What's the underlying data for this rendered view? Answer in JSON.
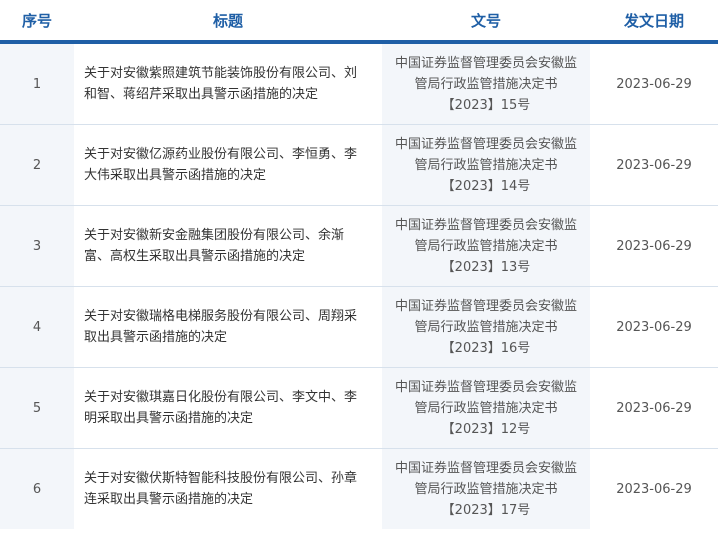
{
  "header": {
    "col_index": "序号",
    "col_title": "标题",
    "col_doc": "文号",
    "col_date": "发文日期"
  },
  "rows": [
    {
      "index": "1",
      "title": "关于对安徽紫照建筑节能装饰股份有限公司、刘和智、蒋绍芹采取出具警示函措施的决定",
      "doc_line1": "中国证券监督管理委员会安徽监",
      "doc_line2": "管局行政监管措施决定书",
      "doc_line3": "【2023】15号",
      "date": "2023-06-29"
    },
    {
      "index": "2",
      "title": "关于对安徽亿源药业股份有限公司、李恒勇、李大伟采取出具警示函措施的决定",
      "doc_line1": "中国证券监督管理委员会安徽监",
      "doc_line2": "管局行政监管措施决定书",
      "doc_line3": "【2023】14号",
      "date": "2023-06-29"
    },
    {
      "index": "3",
      "title": "关于对安徽新安金融集团股份有限公司、余渐富、高权生采取出具警示函措施的决定",
      "doc_line1": "中国证券监督管理委员会安徽监",
      "doc_line2": "管局行政监管措施决定书",
      "doc_line3": "【2023】13号",
      "date": "2023-06-29"
    },
    {
      "index": "4",
      "title": "关于对安徽瑞格电梯服务股份有限公司、周翔采取出具警示函措施的决定",
      "doc_line1": "中国证券监督管理委员会安徽监",
      "doc_line2": "管局行政监管措施决定书",
      "doc_line3": "【2023】16号",
      "date": "2023-06-29"
    },
    {
      "index": "5",
      "title": "关于对安徽琪嘉日化股份有限公司、李文中、李明采取出具警示函措施的决定",
      "doc_line1": "中国证券监督管理委员会安徽监",
      "doc_line2": "管局行政监管措施决定书",
      "doc_line3": "【2023】12号",
      "date": "2023-06-29"
    },
    {
      "index": "6",
      "title": "关于对安徽伏斯特智能科技股份有限公司、孙章连采取出具警示函措施的决定",
      "doc_line1": "中国证券监督管理委员会安徽监",
      "doc_line2": "管局行政监管措施决定书",
      "doc_line3": "【2023】17号",
      "date": "2023-06-29"
    }
  ],
  "colors": {
    "accent": "#1f5fa6",
    "stripe": "#f3f6fa",
    "divider": "#d7e1ec"
  }
}
